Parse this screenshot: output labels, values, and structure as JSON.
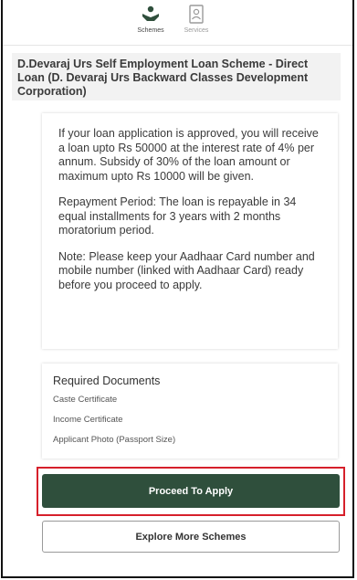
{
  "nav": {
    "items": [
      {
        "label": "Schemes",
        "icon": "hand-heart-icon"
      },
      {
        "label": "Services",
        "icon": "id-card-icon"
      }
    ]
  },
  "scheme": {
    "title": "D.Devaraj Urs Self Employment Loan Scheme - Direct Loan (D. Devaraj Urs Backward Classes Development Corporation)",
    "paragraphs": [
      "If your loan application is approved, you will receive a loan upto Rs 50000 at the interest rate of 4% per annum. Subsidy of 30% of the loan amount or maximum upto Rs 10000 will be given.",
      "Repayment Period: The loan is repayable in 34 equal installments for 3 years with 2 months moratorium period.",
      "Note: Please keep your Aadhaar Card number and mobile number (linked with Aadhaar Card) ready before you proceed to apply."
    ]
  },
  "documents": {
    "title": "Required Documents",
    "items": [
      "Caste Certificate",
      "Income Certificate",
      "Applicant Photo (Passport Size)"
    ]
  },
  "actions": {
    "proceed_label": "Proceed To Apply",
    "explore_label": "Explore More Schemes"
  },
  "colors": {
    "primary": "#2f4f3c",
    "highlight": "#d6202b"
  }
}
